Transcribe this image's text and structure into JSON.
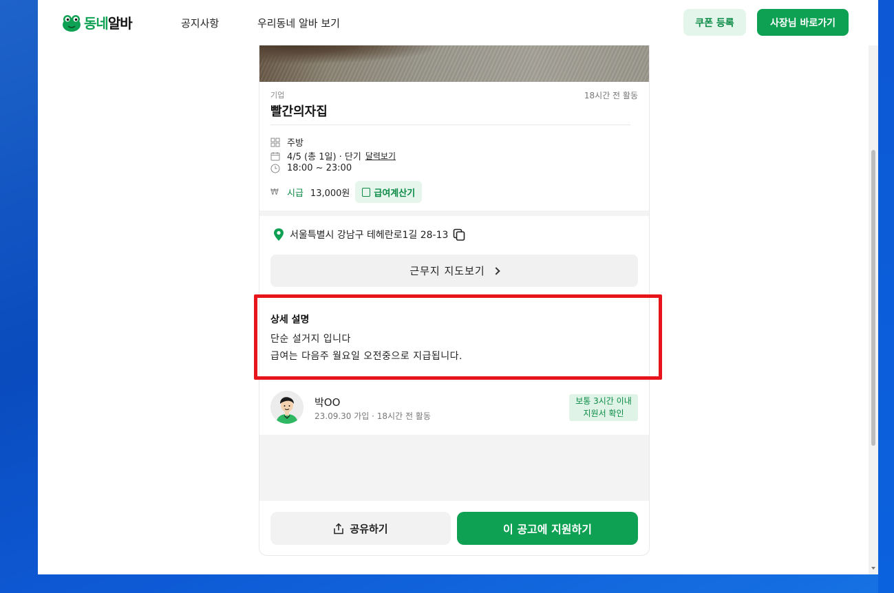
{
  "header": {
    "logo": {
      "part1": "동네",
      "part2": "알바"
    },
    "nav": [
      "공지사항",
      "우리동네 알바 보기"
    ],
    "coupon_label": "쿠폰 등록",
    "owner_label": "사장님 바로가기"
  },
  "job": {
    "section_label": "기업",
    "time_ago": "18시간 전 활동",
    "company": "빨간의자집",
    "category": "주방",
    "schedule": "4/5 (총 1일) · 단기",
    "calendar_link": "달력보기",
    "hours": "18:00 ~ 23:00",
    "wage_label": "시급",
    "wage": "13,000원",
    "calc_label": "급여계산기",
    "address": "서울특별시 강남구 테헤란로1길 28-13",
    "map_label": "근무지 지도보기"
  },
  "description": {
    "title": "상세 설명",
    "lines": [
      "단순 설거지 입니다",
      "급여는 다음주 월요일 오전중으로 지급됩니다."
    ]
  },
  "owner": {
    "name": "박OO",
    "meta": "23.09.30 가입 · 18시간 전 활동",
    "badge_line1": "보통 3시간 이내",
    "badge_line2": "지원서 확인"
  },
  "actions": {
    "share_label": "공유하기",
    "apply_label": "이 공고에 지원하기"
  },
  "colors": {
    "brand_green": "#0ea153",
    "highlight_red": "#e8141b"
  }
}
